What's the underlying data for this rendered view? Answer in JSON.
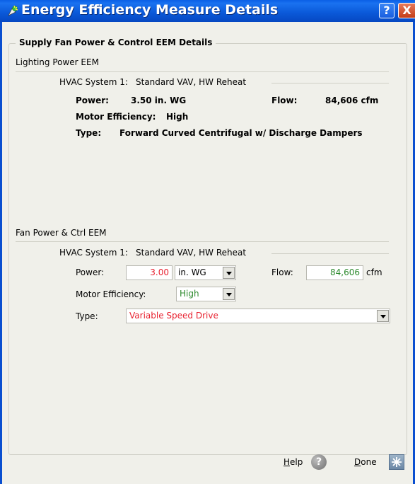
{
  "window": {
    "title": "Energy Efficiency Measure Details",
    "help_glyph": "?",
    "close_glyph": "X"
  },
  "group": {
    "legend": "Supply Fan Power & Control EEM Details"
  },
  "lighting": {
    "header": "Lighting Power EEM",
    "system_label": "HVAC System 1:",
    "system_value": "Standard VAV, HW Reheat",
    "power_label": "Power:",
    "power_value": "3.50 in. WG",
    "flow_label": "Flow:",
    "flow_value": "84,606 cfm",
    "motor_label": "Motor Efficiency:",
    "motor_value": "High",
    "type_label": "Type:",
    "type_value": "Forward Curved Centrifugal w/ Discharge Dampers"
  },
  "fan": {
    "header": "Fan Power & Ctrl EEM",
    "system_label": "HVAC System 1:",
    "system_value": "Standard VAV, HW Reheat",
    "power_label": "Power:",
    "power_value": "3.00",
    "power_unit": "in. WG",
    "flow_label": "Flow:",
    "flow_value": "84,606",
    "flow_unit": "cfm",
    "motor_label": "Motor Efficiency:",
    "motor_value": "High",
    "type_label": "Type:",
    "type_value": "Variable Speed Drive"
  },
  "footer": {
    "help_label_first": "H",
    "help_label_rest": "elp",
    "help_icon_glyph": "?",
    "done_label_first": "D",
    "done_label_rest": "one"
  },
  "colors": {
    "modified_value": "#e8212f",
    "original_value": "#2d8a2d",
    "title_bar": "#0a58d8"
  },
  "icons": [
    "window-app-icon",
    "help-icon",
    "close-icon",
    "dropdown-arrow-icon",
    "help-circle-icon",
    "done-icon"
  ]
}
